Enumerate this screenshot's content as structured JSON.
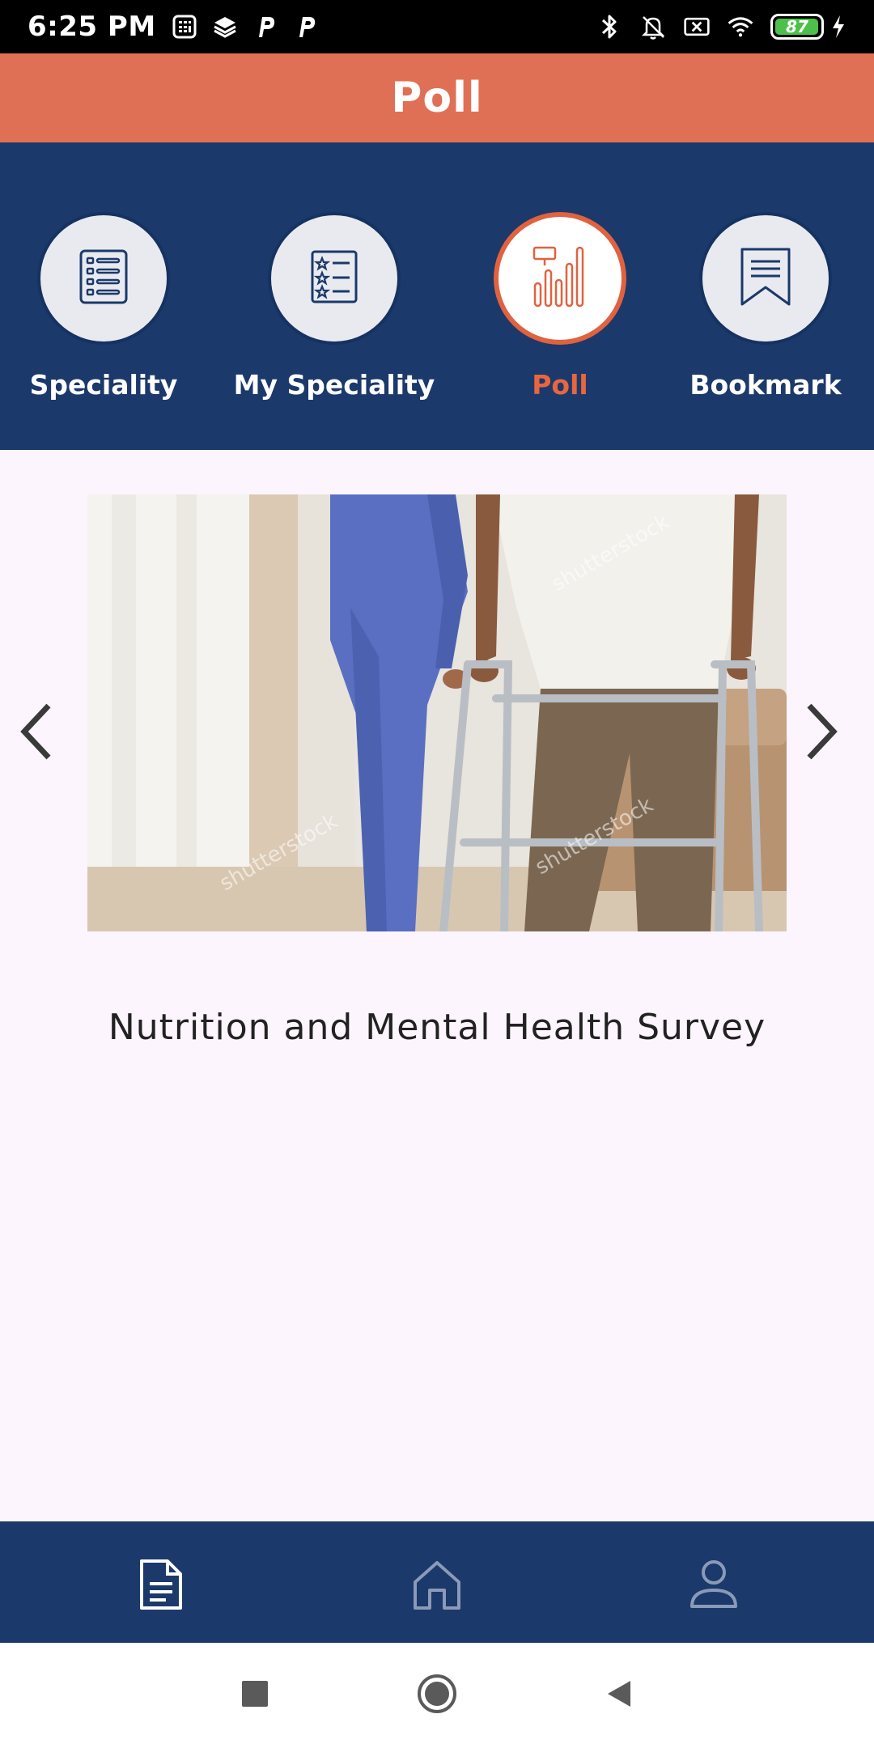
{
  "status_bar": {
    "time": "6:25 PM",
    "battery_level": "87",
    "left_icons": [
      "calculator-icon",
      "layers-icon",
      "p-icon",
      "p-icon"
    ],
    "right_icons": [
      "bluetooth-icon",
      "bell-off-icon",
      "sim-off-icon",
      "wifi-icon",
      "battery-icon",
      "charging-icon"
    ]
  },
  "header": {
    "title": "Poll"
  },
  "categories": [
    {
      "label": "Speciality",
      "icon": "list-icon",
      "active": false
    },
    {
      "label": "My Speciality",
      "icon": "star-list-icon",
      "active": false
    },
    {
      "label": "Poll",
      "icon": "poll-chart-icon",
      "active": true
    },
    {
      "label": "Bookmark",
      "icon": "bookmark-icon",
      "active": false
    }
  ],
  "carousel": {
    "image": "nurse-helping-patient-with-walker-photo",
    "watermark": "shutterstock",
    "title": "Nutrition and Mental Health Survey"
  },
  "bottom_nav": [
    "document-icon",
    "home-icon",
    "profile-icon"
  ],
  "system_nav": [
    "recents-icon",
    "home-circle-icon",
    "back-icon"
  ],
  "colors": {
    "header": "#e07055",
    "panel": "#1b396a",
    "accent": "#e0623f",
    "content_bg": "#fcf5fd"
  }
}
